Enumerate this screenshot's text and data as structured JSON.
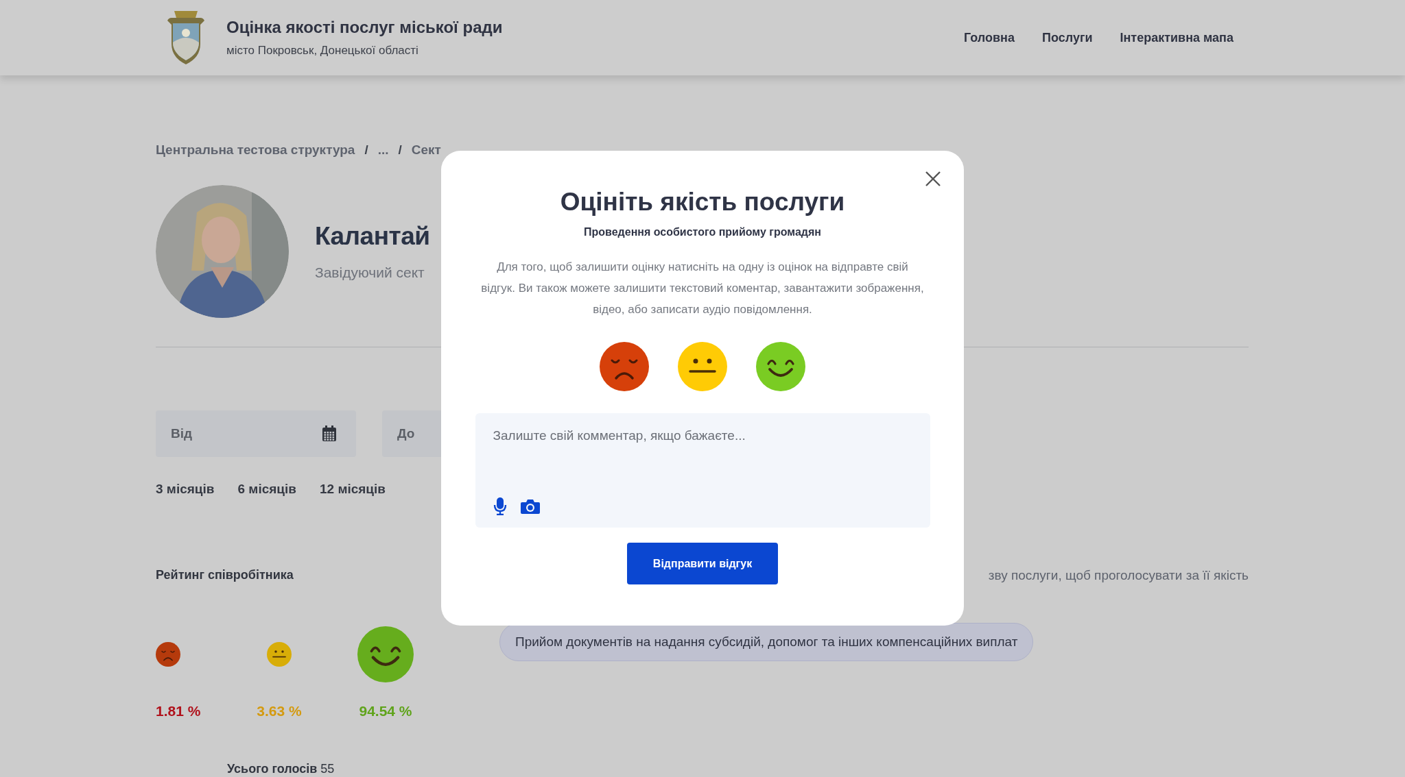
{
  "header": {
    "title": "Оцінка якості послуг міської ради",
    "subtitle": "місто Покровськ, Донецької області",
    "nav": [
      {
        "label": "Головна"
      },
      {
        "label": "Послуги"
      },
      {
        "label": "Інтерактивна мапа"
      }
    ]
  },
  "breadcrumb": {
    "separator": "/",
    "items": [
      "Центральна тестова структура",
      "...",
      "Сект"
    ]
  },
  "profile": {
    "name": "Калантай",
    "position": "Завідуючий сект"
  },
  "date_fields": [
    {
      "placeholder": "Від",
      "calendar": true
    },
    {
      "placeholder": "До"
    }
  ],
  "periods": [
    "3 місяців",
    "6 місяців",
    "12 місяців"
  ],
  "rating": {
    "title": "Рейтинг співробітника",
    "items": [
      {
        "kind": "sad",
        "percent": "1.81 %"
      },
      {
        "kind": "neutral",
        "percent": "3.63 %"
      },
      {
        "kind": "happy",
        "percent": "94.54 %"
      }
    ],
    "total_label": "Усього голосів",
    "total_value": "55"
  },
  "services": {
    "hint": "зву послуги, щоб проголосувати за її якість",
    "items": [
      "Прийом документів на надання субсидій, допомог та інших компенсаційних виплат"
    ]
  },
  "modal": {
    "title": "Оцініть якість послуги",
    "subtitle": "Проведення особистого прийому громадян",
    "description": "Для того, щоб залишити оцінку натисніть на одну із оцінок на відправте свій відгук. Ви також можете залишити текстовий коментар, завантажити зображення, відео, або записати аудіо повідомлення.",
    "faces": [
      {
        "kind": "sad"
      },
      {
        "kind": "neutral"
      },
      {
        "kind": "happy"
      }
    ],
    "comment_placeholder": "Залиште свій комментар, якщо бажаєте...",
    "submit": "Відправити відгук"
  }
}
